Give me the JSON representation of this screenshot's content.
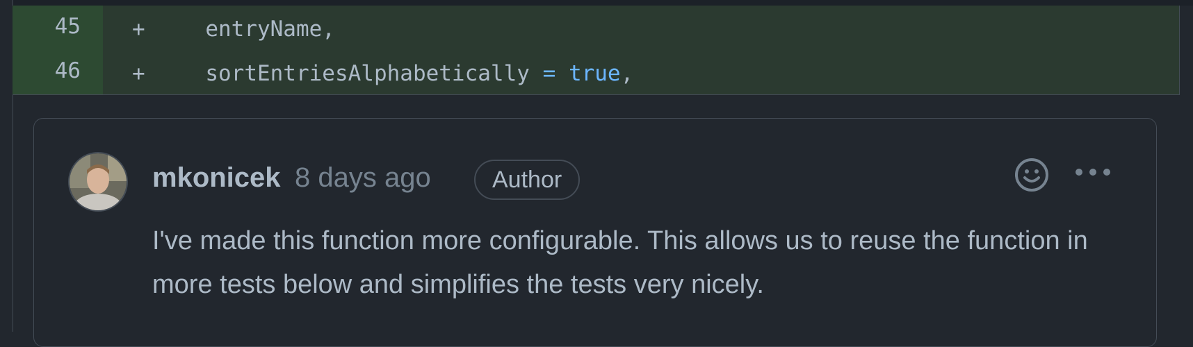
{
  "diff": {
    "rows": [
      {
        "line_number": "45",
        "marker": "+",
        "code": "  entryName,"
      },
      {
        "line_number": "46",
        "marker": "+",
        "code_prefix": "  sortEntriesAlphabetically ",
        "code_operator": "=",
        "code_keyword": "true",
        "code_suffix": ","
      }
    ]
  },
  "comment": {
    "author": "mkonicek",
    "timestamp": "8 days ago",
    "badge": "Author",
    "body": "I've made this function more configurable. This allows us to reuse the function in more tests below and simplifies the tests very nicely.",
    "icons": {
      "avatar": "user-avatar",
      "reaction": "smiley-icon",
      "more": "kebab-horizontal-icon"
    }
  },
  "colors": {
    "background": "#22272e",
    "added_line_bg": "#2b3a30",
    "added_num_bg": "#2d4a32",
    "keyword": "#6cb6ff",
    "muted_text": "#768390",
    "border": "#444c56"
  }
}
